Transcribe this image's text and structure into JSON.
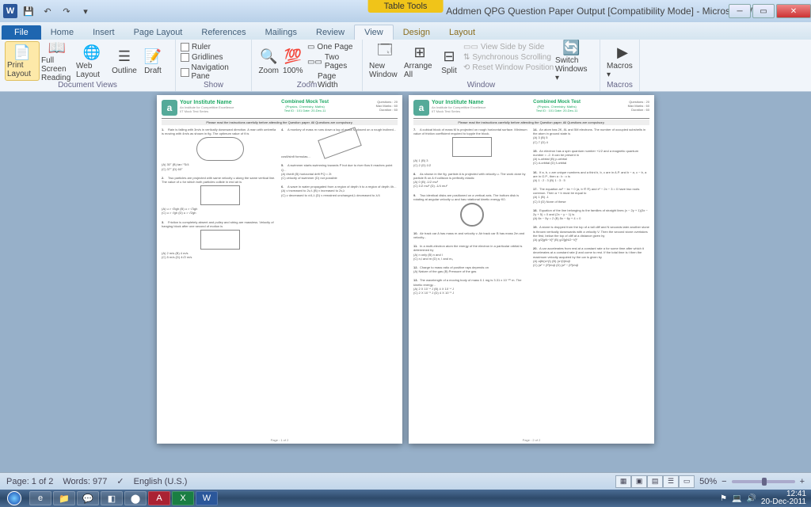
{
  "title": "Addmen QPG Question Paper Output [Compatibility Mode] - Microsoft Word",
  "table_tools": "Table Tools",
  "tabs": {
    "file": "File",
    "home": "Home",
    "insert": "Insert",
    "page_layout": "Page Layout",
    "references": "References",
    "mailings": "Mailings",
    "review": "Review",
    "view": "View",
    "design": "Design",
    "layout": "Layout"
  },
  "ribbon": {
    "views": {
      "print": "Print Layout",
      "full": "Full Screen Reading",
      "web": "Web Layout",
      "outline": "Outline",
      "draft": "Draft",
      "label": "Document Views"
    },
    "show": {
      "ruler": "Ruler",
      "gridlines": "Gridlines",
      "nav": "Navigation Pane",
      "label": "Show"
    },
    "zoom": {
      "zoom": "Zoom",
      "p100": "100%",
      "one": "One Page",
      "two": "Two Pages",
      "width": "Page Width",
      "label": "Zoom"
    },
    "window": {
      "new": "New Window",
      "arrange": "Arrange All",
      "split": "Split",
      "side": "View Side by Side",
      "sync": "Synchronous Scrolling",
      "reset": "Reset Window Position",
      "switch": "Switch Windows ▾",
      "label": "Window"
    },
    "macros": {
      "macros": "Macros ▾",
      "label": "Macros"
    }
  },
  "doc": {
    "institute": "Your Institute Name",
    "institute_sub": "An Institute for Competitive Excellence",
    "series": "IIT Mock Test Series",
    "test_name": "Combined Mock Test",
    "subjects": "(Physics, Chemistry, Maths)",
    "test_id": "Test ID : 101 Date: 20-Dec-11",
    "questions": "Questions : 20",
    "marks": "Max Marks : 60",
    "duration": "Duration : 60",
    "instr": "Please read the instructions carefully before attending the Question paper. All Questions are compulsory.",
    "page1_foot": "Page : 1 of 2",
    "page2_foot": "Page : 2 of 2"
  },
  "status": {
    "page": "Page: 1 of 2",
    "words": "Words: 977",
    "lang": "English (U.S.)",
    "zoom": "50%"
  },
  "clock": {
    "time": "12:41",
    "date": "20-Dec-2011"
  }
}
